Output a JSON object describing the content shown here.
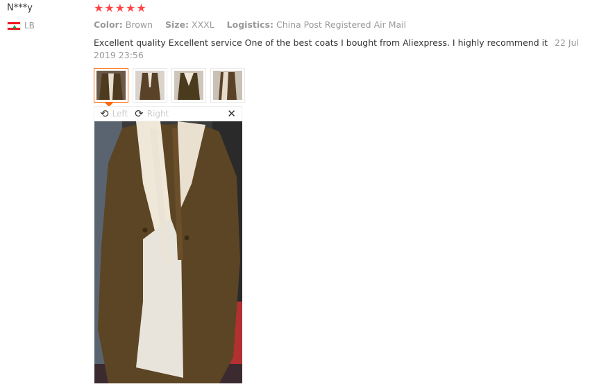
{
  "reviewer": {
    "name": "N***y",
    "country": "LB",
    "flag_icon": "lebanon-flag-icon"
  },
  "rating": {
    "stars": 5,
    "max": 5,
    "color": "#ff4747"
  },
  "attributes": [
    {
      "key": "Color:",
      "value": "Brown"
    },
    {
      "key": "Size:",
      "value": "XXXL"
    },
    {
      "key": "Logistics:",
      "value": "China Post Registered Air Mail"
    }
  ],
  "review": {
    "text": "Excellent quality Excellent service One of the best coats I bought from Aliexpress. I highly recommend it",
    "date": "22 Jul 2019 23:56"
  },
  "photos": {
    "count": 4,
    "active_index": 0
  },
  "viewer": {
    "rotate_left_label": "Left",
    "rotate_right_label": "Right",
    "close_icon": "close-icon"
  }
}
